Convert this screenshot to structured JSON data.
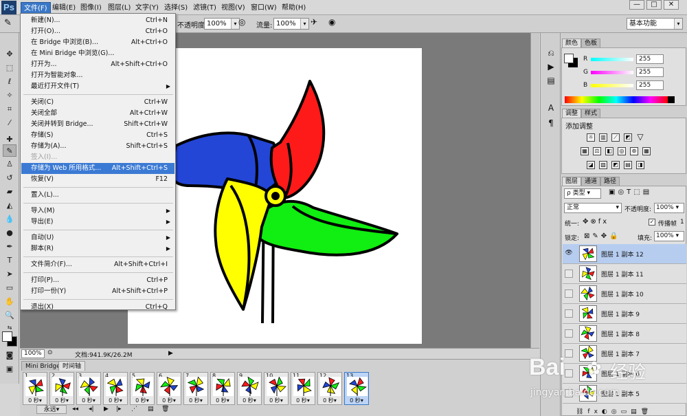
{
  "app": {
    "logo": "Ps"
  },
  "menubar": [
    "文件(F)",
    "编辑(E)",
    "图像(I)",
    "图层(L)",
    "文字(Y)",
    "选择(S)",
    "滤镜(T)",
    "视图(V)",
    "窗口(W)",
    "帮助(H)"
  ],
  "window_buttons": [
    "—",
    "□",
    "✕"
  ],
  "options": {
    "opacity_label": "不透明度:",
    "opacity_value": "100%",
    "flow_label": "流量:",
    "flow_value": "100%",
    "workspace_preset": "基本功能"
  },
  "file_menu": [
    {
      "label": "新建(N)...",
      "shortcut": "Ctrl+N"
    },
    {
      "label": "打开(O)...",
      "shortcut": "Ctrl+O"
    },
    {
      "label": "在 Bridge 中浏览(B)...",
      "shortcut": "Alt+Ctrl+O"
    },
    {
      "label": "在 Mini Bridge 中浏览(G)...",
      "shortcut": ""
    },
    {
      "label": "打开为...",
      "shortcut": "Alt+Shift+Ctrl+O"
    },
    {
      "label": "打开为智能对象...",
      "shortcut": ""
    },
    {
      "label": "最近打开文件(T)",
      "shortcut": "",
      "submenu": true
    },
    {
      "label": "关闭(C)",
      "shortcut": "Ctrl+W"
    },
    {
      "label": "关闭全部",
      "shortcut": "Alt+Ctrl+W"
    },
    {
      "label": "关闭并转到 Bridge...",
      "shortcut": "Shift+Ctrl+W"
    },
    {
      "label": "存储(S)",
      "shortcut": "Ctrl+S"
    },
    {
      "label": "存储为(A)...",
      "shortcut": "Shift+Ctrl+S"
    },
    {
      "label": "签入(I)...",
      "shortcut": "",
      "disabled": true
    },
    {
      "label": "存储为 Web 所用格式...",
      "shortcut": "Alt+Shift+Ctrl+S",
      "highlighted": true
    },
    {
      "label": "恢复(V)",
      "shortcut": "F12"
    },
    {
      "label": "置入(L)...",
      "shortcut": ""
    },
    {
      "label": "导入(M)",
      "shortcut": "",
      "submenu": true
    },
    {
      "label": "导出(E)",
      "shortcut": "",
      "submenu": true
    },
    {
      "label": "自动(U)",
      "shortcut": "",
      "submenu": true
    },
    {
      "label": "脚本(R)",
      "shortcut": "",
      "submenu": true
    },
    {
      "label": "文件简介(F)...",
      "shortcut": "Alt+Shift+Ctrl+I"
    },
    {
      "label": "打印(P)...",
      "shortcut": "Ctrl+P"
    },
    {
      "label": "打印一份(Y)",
      "shortcut": "Alt+Shift+Ctrl+P"
    },
    {
      "label": "退出(X)",
      "shortcut": "Ctrl+Q"
    }
  ],
  "status": {
    "zoom": "100%",
    "doc_info": "文档:941.9K/26.2M"
  },
  "timeline": {
    "tabs": [
      "Mini Bridge",
      "时间轴"
    ],
    "frames": [
      {
        "num": "1",
        "dur": "0 秒"
      },
      {
        "num": "2",
        "dur": "0 秒"
      },
      {
        "num": "3",
        "dur": "0 秒"
      },
      {
        "num": "4",
        "dur": "0 秒"
      },
      {
        "num": "5",
        "dur": "0 秒"
      },
      {
        "num": "6",
        "dur": "0 秒"
      },
      {
        "num": "7",
        "dur": "0 秒"
      },
      {
        "num": "8",
        "dur": "0 秒"
      },
      {
        "num": "9",
        "dur": "0 秒"
      },
      {
        "num": "10",
        "dur": "0 秒"
      },
      {
        "num": "11",
        "dur": "0 秒"
      },
      {
        "num": "12",
        "dur": "0 秒"
      },
      {
        "num": "13",
        "dur": "0 秒"
      }
    ],
    "loop": "永远",
    "selected_frame": "13"
  },
  "color_panel": {
    "tabs": [
      "颜色",
      "色板"
    ],
    "r_label": "R",
    "g_label": "G",
    "b_label": "B",
    "r": "255",
    "g": "255",
    "b": "255"
  },
  "adjust_panel": {
    "tabs": [
      "调整",
      "样式"
    ],
    "title": "添加调整"
  },
  "layers_panel": {
    "tabs": [
      "图层",
      "通道",
      "路径"
    ],
    "filter": "类型",
    "blend": "正常",
    "opacity_label": "不透明度:",
    "opacity": "100%",
    "unify_label": "统一:",
    "propagate_label": "传播帧",
    "propagate_value": "1",
    "lock_label": "锁定:",
    "fill_label": "填充:",
    "fill": "100%",
    "layers": [
      {
        "name": "图层 1 副本 12",
        "visible": true,
        "selected": true
      },
      {
        "name": "图层 1 副本 11",
        "visible": false
      },
      {
        "name": "图层 1 副本 10",
        "visible": false
      },
      {
        "name": "图层 1 副本 9",
        "visible": false
      },
      {
        "name": "图层 1 副本 8",
        "visible": false
      },
      {
        "name": "图层 1 副本 7",
        "visible": false
      },
      {
        "name": "图层 1 副本 6",
        "visible": false
      },
      {
        "name": "图层 1 副本 5",
        "visible": false
      }
    ]
  },
  "watermark": {
    "brand": "Bai",
    "brand2": "经验",
    "url": "jingyan.baidu.com"
  },
  "colors": {
    "red": "#ff1a1a",
    "yellow": "#ffff00",
    "green": "#11ee11",
    "blue": "#2346d6",
    "highlight": "#3b7ad4"
  }
}
